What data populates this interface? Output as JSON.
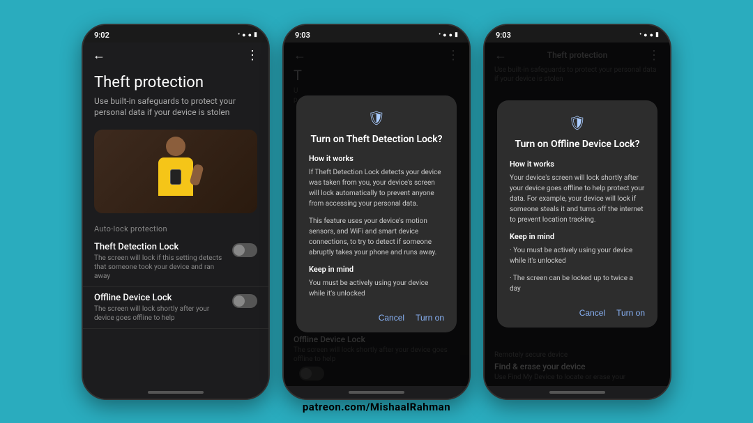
{
  "page": {
    "background_color": "#2aacbe",
    "watermark": "patreon.com/MishaalRahman"
  },
  "phone1": {
    "status_time": "9:02",
    "header_title": "Theft protection",
    "subtitle": "Use built-in safeguards to protect your personal data if your device is stolen",
    "section_label": "Auto-lock protection",
    "settings": [
      {
        "title": "Theft Detection Lock",
        "description": "The screen will lock if this setting detects that someone took your device and ran away"
      },
      {
        "title": "Offline Device Lock",
        "description": "The screen will lock shortly after your device goes offline to help"
      }
    ]
  },
  "phone2": {
    "status_time": "9:03",
    "background_title": "T",
    "background_desc": "U\np",
    "dialog": {
      "icon": "🛡",
      "title": "Turn on Theft Detection Lock?",
      "how_it_works_label": "How it works",
      "body1": "If Theft Detection Lock detects your device was taken from you, your device's screen will lock automatically to prevent anyone from accessing your personal data.",
      "body2": "This feature uses your device's motion sensors, and WiFi and smart device connections, to try to detect if someone abruptly takes your phone and runs away.",
      "keep_in_mind_label": "Keep in mind",
      "body3": "You must be actively using your device while it's unlocked",
      "btn_cancel": "Cancel",
      "btn_confirm": "Turn on"
    },
    "offline_label": "Offline Device Lock",
    "offline_desc": "The screen will lock shortly after your device goes offline to help"
  },
  "phone3": {
    "status_time": "9:03",
    "header_title": "Theft protection",
    "subtitle_partial": "Use built-in safeguards to protect your personal data if your device is stolen",
    "dialog": {
      "icon": "🛡",
      "title": "Turn on Offline Device Lock?",
      "how_it_works_label": "How it works",
      "body1": "Your device's screen will lock shortly after your device goes offline to help protect your data. For example, your device will lock if someone steals it and turns off the internet to prevent location tracking.",
      "keep_in_mind_label": "Keep in mind",
      "bullet1": "· You must be actively using your device while it's unlocked",
      "bullet2": "· The screen can be locked up to twice a day",
      "btn_cancel": "Cancel",
      "btn_confirm": "Turn on"
    },
    "section_remotely": "Remotely secure device",
    "find_erase_title": "Find & erase your device",
    "find_erase_desc": "Use Find My Device to locate or erase your"
  }
}
